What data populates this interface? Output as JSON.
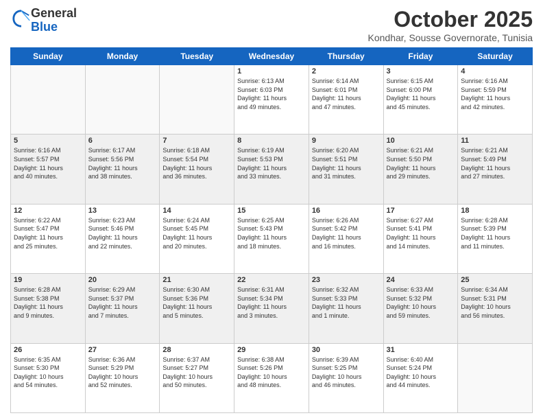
{
  "logo": {
    "general": "General",
    "blue": "Blue"
  },
  "header": {
    "month": "October 2025",
    "location": "Kondhar, Sousse Governorate, Tunisia"
  },
  "days_of_week": [
    "Sunday",
    "Monday",
    "Tuesday",
    "Wednesday",
    "Thursday",
    "Friday",
    "Saturday"
  ],
  "weeks": [
    {
      "shaded": false,
      "days": [
        {
          "num": "",
          "info": ""
        },
        {
          "num": "",
          "info": ""
        },
        {
          "num": "",
          "info": ""
        },
        {
          "num": "1",
          "info": "Sunrise: 6:13 AM\nSunset: 6:03 PM\nDaylight: 11 hours\nand 49 minutes."
        },
        {
          "num": "2",
          "info": "Sunrise: 6:14 AM\nSunset: 6:01 PM\nDaylight: 11 hours\nand 47 minutes."
        },
        {
          "num": "3",
          "info": "Sunrise: 6:15 AM\nSunset: 6:00 PM\nDaylight: 11 hours\nand 45 minutes."
        },
        {
          "num": "4",
          "info": "Sunrise: 6:16 AM\nSunset: 5:59 PM\nDaylight: 11 hours\nand 42 minutes."
        }
      ]
    },
    {
      "shaded": true,
      "days": [
        {
          "num": "5",
          "info": "Sunrise: 6:16 AM\nSunset: 5:57 PM\nDaylight: 11 hours\nand 40 minutes."
        },
        {
          "num": "6",
          "info": "Sunrise: 6:17 AM\nSunset: 5:56 PM\nDaylight: 11 hours\nand 38 minutes."
        },
        {
          "num": "7",
          "info": "Sunrise: 6:18 AM\nSunset: 5:54 PM\nDaylight: 11 hours\nand 36 minutes."
        },
        {
          "num": "8",
          "info": "Sunrise: 6:19 AM\nSunset: 5:53 PM\nDaylight: 11 hours\nand 33 minutes."
        },
        {
          "num": "9",
          "info": "Sunrise: 6:20 AM\nSunset: 5:51 PM\nDaylight: 11 hours\nand 31 minutes."
        },
        {
          "num": "10",
          "info": "Sunrise: 6:21 AM\nSunset: 5:50 PM\nDaylight: 11 hours\nand 29 minutes."
        },
        {
          "num": "11",
          "info": "Sunrise: 6:21 AM\nSunset: 5:49 PM\nDaylight: 11 hours\nand 27 minutes."
        }
      ]
    },
    {
      "shaded": false,
      "days": [
        {
          "num": "12",
          "info": "Sunrise: 6:22 AM\nSunset: 5:47 PM\nDaylight: 11 hours\nand 25 minutes."
        },
        {
          "num": "13",
          "info": "Sunrise: 6:23 AM\nSunset: 5:46 PM\nDaylight: 11 hours\nand 22 minutes."
        },
        {
          "num": "14",
          "info": "Sunrise: 6:24 AM\nSunset: 5:45 PM\nDaylight: 11 hours\nand 20 minutes."
        },
        {
          "num": "15",
          "info": "Sunrise: 6:25 AM\nSunset: 5:43 PM\nDaylight: 11 hours\nand 18 minutes."
        },
        {
          "num": "16",
          "info": "Sunrise: 6:26 AM\nSunset: 5:42 PM\nDaylight: 11 hours\nand 16 minutes."
        },
        {
          "num": "17",
          "info": "Sunrise: 6:27 AM\nSunset: 5:41 PM\nDaylight: 11 hours\nand 14 minutes."
        },
        {
          "num": "18",
          "info": "Sunrise: 6:28 AM\nSunset: 5:39 PM\nDaylight: 11 hours\nand 11 minutes."
        }
      ]
    },
    {
      "shaded": true,
      "days": [
        {
          "num": "19",
          "info": "Sunrise: 6:28 AM\nSunset: 5:38 PM\nDaylight: 11 hours\nand 9 minutes."
        },
        {
          "num": "20",
          "info": "Sunrise: 6:29 AM\nSunset: 5:37 PM\nDaylight: 11 hours\nand 7 minutes."
        },
        {
          "num": "21",
          "info": "Sunrise: 6:30 AM\nSunset: 5:36 PM\nDaylight: 11 hours\nand 5 minutes."
        },
        {
          "num": "22",
          "info": "Sunrise: 6:31 AM\nSunset: 5:34 PM\nDaylight: 11 hours\nand 3 minutes."
        },
        {
          "num": "23",
          "info": "Sunrise: 6:32 AM\nSunset: 5:33 PM\nDaylight: 11 hours\nand 1 minute."
        },
        {
          "num": "24",
          "info": "Sunrise: 6:33 AM\nSunset: 5:32 PM\nDaylight: 10 hours\nand 59 minutes."
        },
        {
          "num": "25",
          "info": "Sunrise: 6:34 AM\nSunset: 5:31 PM\nDaylight: 10 hours\nand 56 minutes."
        }
      ]
    },
    {
      "shaded": false,
      "days": [
        {
          "num": "26",
          "info": "Sunrise: 6:35 AM\nSunset: 5:30 PM\nDaylight: 10 hours\nand 54 minutes."
        },
        {
          "num": "27",
          "info": "Sunrise: 6:36 AM\nSunset: 5:29 PM\nDaylight: 10 hours\nand 52 minutes."
        },
        {
          "num": "28",
          "info": "Sunrise: 6:37 AM\nSunset: 5:27 PM\nDaylight: 10 hours\nand 50 minutes."
        },
        {
          "num": "29",
          "info": "Sunrise: 6:38 AM\nSunset: 5:26 PM\nDaylight: 10 hours\nand 48 minutes."
        },
        {
          "num": "30",
          "info": "Sunrise: 6:39 AM\nSunset: 5:25 PM\nDaylight: 10 hours\nand 46 minutes."
        },
        {
          "num": "31",
          "info": "Sunrise: 6:40 AM\nSunset: 5:24 PM\nDaylight: 10 hours\nand 44 minutes."
        },
        {
          "num": "",
          "info": ""
        }
      ]
    }
  ]
}
